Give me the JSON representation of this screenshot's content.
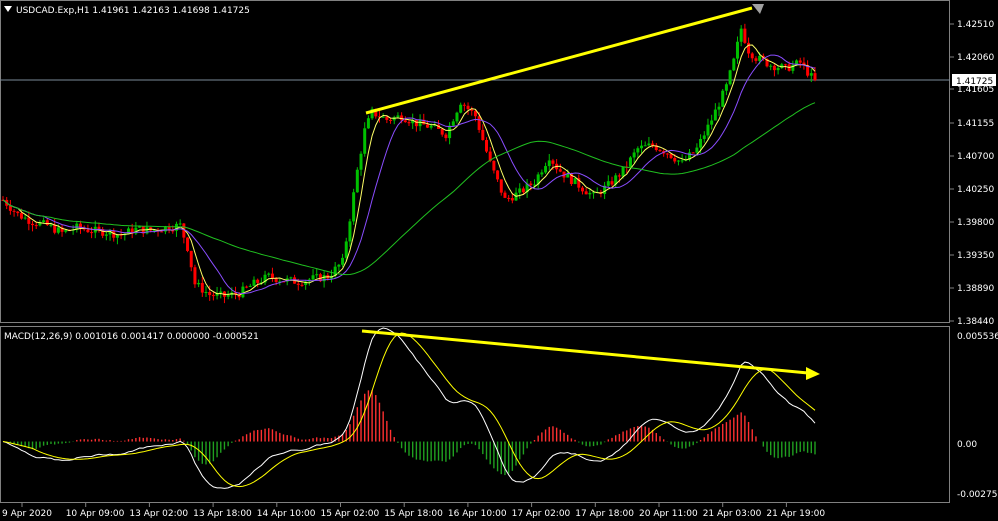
{
  "header": {
    "symbol_line": "USDCAD.Exp,H1  1.41961 1.42163 1.41698 1.41725"
  },
  "price_axis": {
    "ticks": [
      "1.42510",
      "1.42060",
      "1.41605",
      "1.41155",
      "1.40700",
      "1.40250",
      "1.39800",
      "1.39350",
      "1.38890",
      "1.38440"
    ],
    "current_price": "1.41725"
  },
  "macd_panel": {
    "label": "MACD(12,26,9) 0.001016 0.001417 0.000000 -0.000521",
    "ticks": [
      "0.005536",
      "0.00",
      "-0.002752"
    ]
  },
  "time_axis": {
    "ticks": [
      "9 Apr 2020",
      "10 Apr 09:00",
      "13 Apr 02:00",
      "13 Apr 18:00",
      "14 Apr 10:00",
      "15 Apr 02:00",
      "15 Apr 18:00",
      "16 Apr 10:00",
      "17 Apr 02:00",
      "17 Apr 18:00",
      "20 Apr 11:00",
      "21 Apr 03:00",
      "21 Apr 19:00"
    ]
  },
  "colors": {
    "background": "#000000",
    "bull_candle": "#00c000",
    "bear_candle": "#ff0000",
    "ma_fast": "#ffff66",
    "ma_slow": "#8a4dff",
    "ma_long": "#20c020",
    "trendline": "#ffff00",
    "macd_line": "#ffffff",
    "signal_line": "#ffff00",
    "hist_pos": "#ff3030",
    "hist_neg": "#20a020"
  },
  "chart_data": {
    "type": "candlestick",
    "symbol": "USDCAD.Exp",
    "timeframe": "H1",
    "last_bar": {
      "open": 1.41961,
      "high": 1.42163,
      "low": 1.41698,
      "close": 1.41725
    },
    "ylim": [
      1.3844,
      1.4251
    ],
    "macd": {
      "main": 0.001016,
      "signal": 0.001417,
      "ylim": [
        -0.002752,
        0.005536
      ]
    },
    "price_path": [
      [
        0,
        1.401
      ],
      [
        4,
        1.399
      ],
      [
        8,
        1.398
      ],
      [
        12,
        1.3975
      ],
      [
        16,
        1.3965
      ],
      [
        20,
        1.3972
      ],
      [
        24,
        1.3968
      ],
      [
        28,
        1.3966
      ],
      [
        32,
        1.3962
      ],
      [
        36,
        1.397
      ],
      [
        40,
        1.3968
      ],
      [
        44,
        1.3972
      ],
      [
        48,
        1.3975
      ],
      [
        50,
        1.3945
      ],
      [
        52,
        1.3895
      ],
      [
        56,
        1.388
      ],
      [
        60,
        1.3878
      ],
      [
        64,
        1.3882
      ],
      [
        68,
        1.3895
      ],
      [
        72,
        1.3905
      ],
      [
        76,
        1.39
      ],
      [
        80,
        1.3898
      ],
      [
        84,
        1.3902
      ],
      [
        88,
        1.3905
      ],
      [
        92,
        1.3925
      ],
      [
        94,
        1.3985
      ],
      [
        96,
        1.405
      ],
      [
        98,
        1.4105
      ],
      [
        100,
        1.413
      ],
      [
        104,
        1.412
      ],
      [
        108,
        1.4125
      ],
      [
        112,
        1.4115
      ],
      [
        116,
        1.411
      ],
      [
        120,
        1.41
      ],
      [
        124,
        1.4145
      ],
      [
        128,
        1.4125
      ],
      [
        132,
        1.406
      ],
      [
        136,
        1.401
      ],
      [
        140,
        1.402
      ],
      [
        144,
        1.4035
      ],
      [
        148,
        1.407
      ],
      [
        150,
        1.4055
      ],
      [
        152,
        1.4045
      ],
      [
        156,
        1.403
      ],
      [
        160,
        1.4015
      ],
      [
        164,
        1.403
      ],
      [
        168,
        1.405
      ],
      [
        172,
        1.408
      ],
      [
        176,
        1.4085
      ],
      [
        180,
        1.4075
      ],
      [
        184,
        1.406
      ],
      [
        188,
        1.408
      ],
      [
        192,
        1.412
      ],
      [
        196,
        1.4165
      ],
      [
        198,
        1.42
      ],
      [
        200,
        1.4245
      ],
      [
        202,
        1.4215
      ],
      [
        204,
        1.4205
      ],
      [
        208,
        1.4195
      ],
      [
        212,
        1.419
      ],
      [
        216,
        1.4198
      ],
      [
        220,
        1.4172
      ]
    ]
  }
}
